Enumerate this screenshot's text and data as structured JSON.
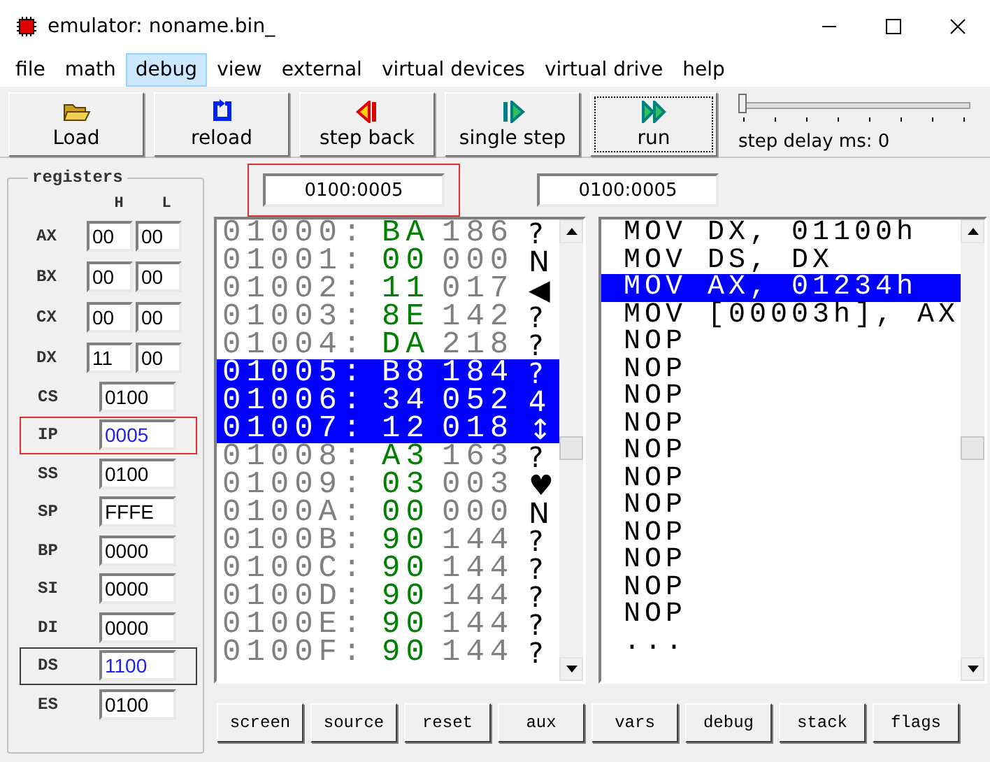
{
  "window": {
    "title": "emulator: noname.bin_"
  },
  "menu": [
    {
      "label": "file",
      "selected": false
    },
    {
      "label": "math",
      "selected": false
    },
    {
      "label": "debug",
      "selected": true
    },
    {
      "label": "view",
      "selected": false
    },
    {
      "label": "external",
      "selected": false
    },
    {
      "label": "virtual devices",
      "selected": false
    },
    {
      "label": "virtual drive",
      "selected": false
    },
    {
      "label": "help",
      "selected": false
    }
  ],
  "toolbar": [
    {
      "label": "Load",
      "kind": "load",
      "focused": false
    },
    {
      "label": "reload",
      "kind": "reload",
      "focused": false
    },
    {
      "label": "step back",
      "kind": "back",
      "focused": false
    },
    {
      "label": "single step",
      "kind": "step",
      "focused": false
    },
    {
      "label": "run",
      "kind": "run",
      "focused": true
    }
  ],
  "step_delay": {
    "label": "step delay ms: 0",
    "level": 0
  },
  "registers": {
    "title": "registers",
    "h": "H",
    "l": "L",
    "pairs": [
      {
        "name": "AX",
        "high": "00",
        "low": "00"
      },
      {
        "name": "BX",
        "high": "00",
        "low": "00"
      },
      {
        "name": "CX",
        "high": "00",
        "low": "00"
      },
      {
        "name": "DX",
        "high": "11",
        "low": "00"
      }
    ],
    "segments": [
      {
        "name": "CS",
        "value": "0100",
        "changed": false,
        "marked": false
      },
      {
        "name": "IP",
        "value": "0005",
        "changed": true,
        "marked": true,
        "color": "#e03030"
      },
      {
        "name": "SS",
        "value": "0100",
        "changed": false,
        "marked": false
      },
      {
        "name": "SP",
        "value": "FFFE",
        "changed": false,
        "marked": false
      },
      {
        "name": "BP",
        "value": "0000",
        "changed": false,
        "marked": false
      },
      {
        "name": "SI",
        "value": "0000",
        "changed": false,
        "marked": false
      },
      {
        "name": "DI",
        "value": "0000",
        "changed": false,
        "marked": false
      },
      {
        "name": "DS",
        "value": "1100",
        "changed": true,
        "marked": true,
        "color": "#404040"
      },
      {
        "name": "ES",
        "value": "0100",
        "changed": false,
        "marked": false
      }
    ]
  },
  "memory": {
    "address": "0100:0005",
    "address_marked": true,
    "rows": [
      {
        "addr": "01000:",
        "hex": "BA",
        "dec": "186",
        "char": "?",
        "selected": false
      },
      {
        "addr": "01001:",
        "hex": "00",
        "dec": "000",
        "char": "N",
        "selected": false
      },
      {
        "addr": "01002:",
        "hex": "11",
        "dec": "017",
        "char": "◀",
        "selected": false
      },
      {
        "addr": "01003:",
        "hex": "8E",
        "dec": "142",
        "char": "?",
        "selected": false
      },
      {
        "addr": "01004:",
        "hex": "DA",
        "dec": "218",
        "char": "?",
        "selected": false
      },
      {
        "addr": "01005:",
        "hex": "B8",
        "dec": "184",
        "char": "?",
        "selected": true
      },
      {
        "addr": "01006:",
        "hex": "34",
        "dec": "052",
        "char": "4",
        "selected": true
      },
      {
        "addr": "01007:",
        "hex": "12",
        "dec": "018",
        "char": "↕",
        "selected": true
      },
      {
        "addr": "01008:",
        "hex": "A3",
        "dec": "163",
        "char": "?",
        "selected": false
      },
      {
        "addr": "01009:",
        "hex": "03",
        "dec": "003",
        "char": "♥",
        "selected": false
      },
      {
        "addr": "0100A:",
        "hex": "00",
        "dec": "000",
        "char": "N",
        "selected": false
      },
      {
        "addr": "0100B:",
        "hex": "90",
        "dec": "144",
        "char": "?",
        "selected": false
      },
      {
        "addr": "0100C:",
        "hex": "90",
        "dec": "144",
        "char": "?",
        "selected": false
      },
      {
        "addr": "0100D:",
        "hex": "90",
        "dec": "144",
        "char": "?",
        "selected": false
      },
      {
        "addr": "0100E:",
        "hex": "90",
        "dec": "144",
        "char": "?",
        "selected": false
      },
      {
        "addr": "0100F:",
        "hex": "90",
        "dec": "144",
        "char": "?",
        "selected": false
      }
    ]
  },
  "disassembly": {
    "address": "0100:0005",
    "lines": [
      {
        "text": "MOV DX, 01100h",
        "selected": false
      },
      {
        "text": "MOV DS, DX",
        "selected": false
      },
      {
        "text": "MOV AX, 01234h",
        "selected": true
      },
      {
        "text": "MOV [00003h], AX",
        "selected": false
      },
      {
        "text": "NOP",
        "selected": false
      },
      {
        "text": "NOP",
        "selected": false
      },
      {
        "text": "NOP",
        "selected": false
      },
      {
        "text": "NOP",
        "selected": false
      },
      {
        "text": "NOP",
        "selected": false
      },
      {
        "text": "NOP",
        "selected": false
      },
      {
        "text": "NOP",
        "selected": false
      },
      {
        "text": "NOP",
        "selected": false
      },
      {
        "text": "NOP",
        "selected": false
      },
      {
        "text": "NOP",
        "selected": false
      },
      {
        "text": "NOP",
        "selected": false
      },
      {
        "text": "...",
        "selected": false
      }
    ]
  },
  "bottom_buttons": [
    "screen",
    "source",
    "reset",
    "aux",
    "vars",
    "debug",
    "stack",
    "flags"
  ]
}
